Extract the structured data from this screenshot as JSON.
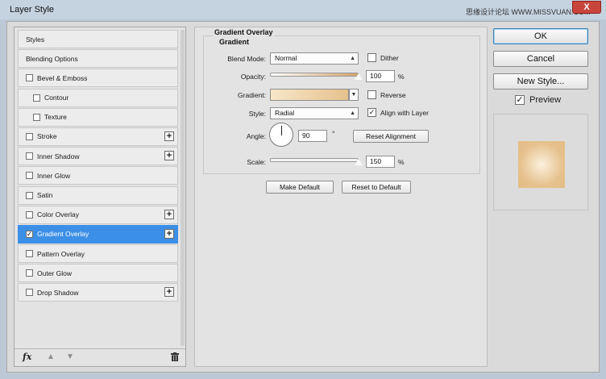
{
  "window": {
    "title": "Layer Style",
    "watermark": "思缘设计论坛 WWW.MISSVUAN.COM",
    "close_label": "X"
  },
  "sidebar": {
    "items": [
      {
        "label": "Styles",
        "checkbox": false,
        "checked": false,
        "plus": false,
        "selected": false,
        "indent": false
      },
      {
        "label": "Blending Options",
        "checkbox": false,
        "checked": false,
        "plus": false,
        "selected": false,
        "indent": false
      },
      {
        "label": "Bevel & Emboss",
        "checkbox": true,
        "checked": false,
        "plus": false,
        "selected": false,
        "indent": false
      },
      {
        "label": "Contour",
        "checkbox": true,
        "checked": false,
        "plus": false,
        "selected": false,
        "indent": true
      },
      {
        "label": "Texture",
        "checkbox": true,
        "checked": false,
        "plus": false,
        "selected": false,
        "indent": true
      },
      {
        "label": "Stroke",
        "checkbox": true,
        "checked": false,
        "plus": true,
        "selected": false,
        "indent": false
      },
      {
        "label": "Inner Shadow",
        "checkbox": true,
        "checked": false,
        "plus": true,
        "selected": false,
        "indent": false
      },
      {
        "label": "Inner Glow",
        "checkbox": true,
        "checked": false,
        "plus": false,
        "selected": false,
        "indent": false
      },
      {
        "label": "Satin",
        "checkbox": true,
        "checked": false,
        "plus": false,
        "selected": false,
        "indent": false
      },
      {
        "label": "Color Overlay",
        "checkbox": true,
        "checked": false,
        "plus": true,
        "selected": false,
        "indent": false
      },
      {
        "label": "Gradient Overlay",
        "checkbox": true,
        "checked": true,
        "plus": true,
        "selected": true,
        "indent": false
      },
      {
        "label": "Pattern Overlay",
        "checkbox": true,
        "checked": false,
        "plus": false,
        "selected": false,
        "indent": false
      },
      {
        "label": "Outer Glow",
        "checkbox": true,
        "checked": false,
        "plus": false,
        "selected": false,
        "indent": false
      },
      {
        "label": "Drop Shadow",
        "checkbox": true,
        "checked": false,
        "plus": true,
        "selected": false,
        "indent": false
      }
    ],
    "footer_icons": [
      "fx-icon",
      "arrow-up-icon",
      "arrow-down-icon",
      "trash-icon"
    ],
    "fx_label": "fx"
  },
  "gradient_overlay": {
    "title": "Gradient Overlay",
    "subtitle": "Gradient",
    "blend_mode_label": "Blend Mode:",
    "blend_mode_value": "Normal",
    "dither_label": "Dither",
    "dither_checked": false,
    "opacity_label": "Opacity:",
    "opacity_value": "100",
    "opacity_unit": "%",
    "opacity_level": 1.0,
    "gradient_label": "Gradient:",
    "gradient_colors": [
      "#f7e6c8",
      "#e6c18d"
    ],
    "reverse_label": "Reverse",
    "reverse_checked": false,
    "style_label": "Style:",
    "style_value": "Radial",
    "align_label": "Align with Layer",
    "align_checked": true,
    "angle_label": "Angle:",
    "angle_value": "90",
    "angle_unit": "°",
    "reset_alignment_label": "Reset Alignment",
    "scale_label": "Scale:",
    "scale_value": "150",
    "scale_unit": "%",
    "scale_level": 1.0,
    "make_default_label": "Make Default",
    "reset_default_label": "Reset to Default"
  },
  "actions": {
    "ok_label": "OK",
    "cancel_label": "Cancel",
    "new_style_label": "New Style...",
    "preview_label": "Preview",
    "preview_checked": true
  },
  "colors": {
    "selected_item": "#3c8fe6",
    "dialog_bg": "#dadada",
    "preview_center": "#fbf0dc",
    "preview_edge": "#e3bc83"
  }
}
